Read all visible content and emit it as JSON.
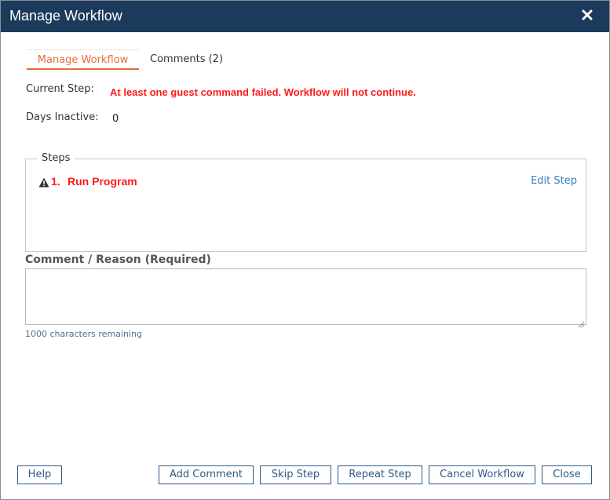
{
  "dialog": {
    "title": "Manage Workflow",
    "close_icon": "close-x-icon"
  },
  "tabs": [
    {
      "label": "Manage Workflow",
      "active": true
    },
    {
      "label": "Comments (2)",
      "active": false
    }
  ],
  "fields": {
    "current_step_label": "Current Step:",
    "current_step_value": "At least one guest command failed. Workflow will not continue.",
    "days_inactive_label": "Days Inactive:",
    "days_inactive_value": "0"
  },
  "steps": {
    "legend": "Steps",
    "items": [
      {
        "icon": "warning-triangle-icon",
        "number": "1.",
        "name": "Run Program",
        "action": "Edit Step"
      }
    ]
  },
  "comment": {
    "label": "Comment / Reason (Required)",
    "value": "",
    "chars_remaining": "1000 characters remaining"
  },
  "buttons": {
    "help": "Help",
    "add_comment": "Add Comment",
    "skip_step": "Skip Step",
    "repeat_step": "Repeat Step",
    "cancel_workflow": "Cancel Workflow",
    "close": "Close"
  },
  "colors": {
    "titlebar": "#1c3a5c",
    "active_tab": "#e46c3a",
    "error_text": "#ff1a1a",
    "link": "#3a7bbf",
    "button_border": "#2f5a85"
  }
}
